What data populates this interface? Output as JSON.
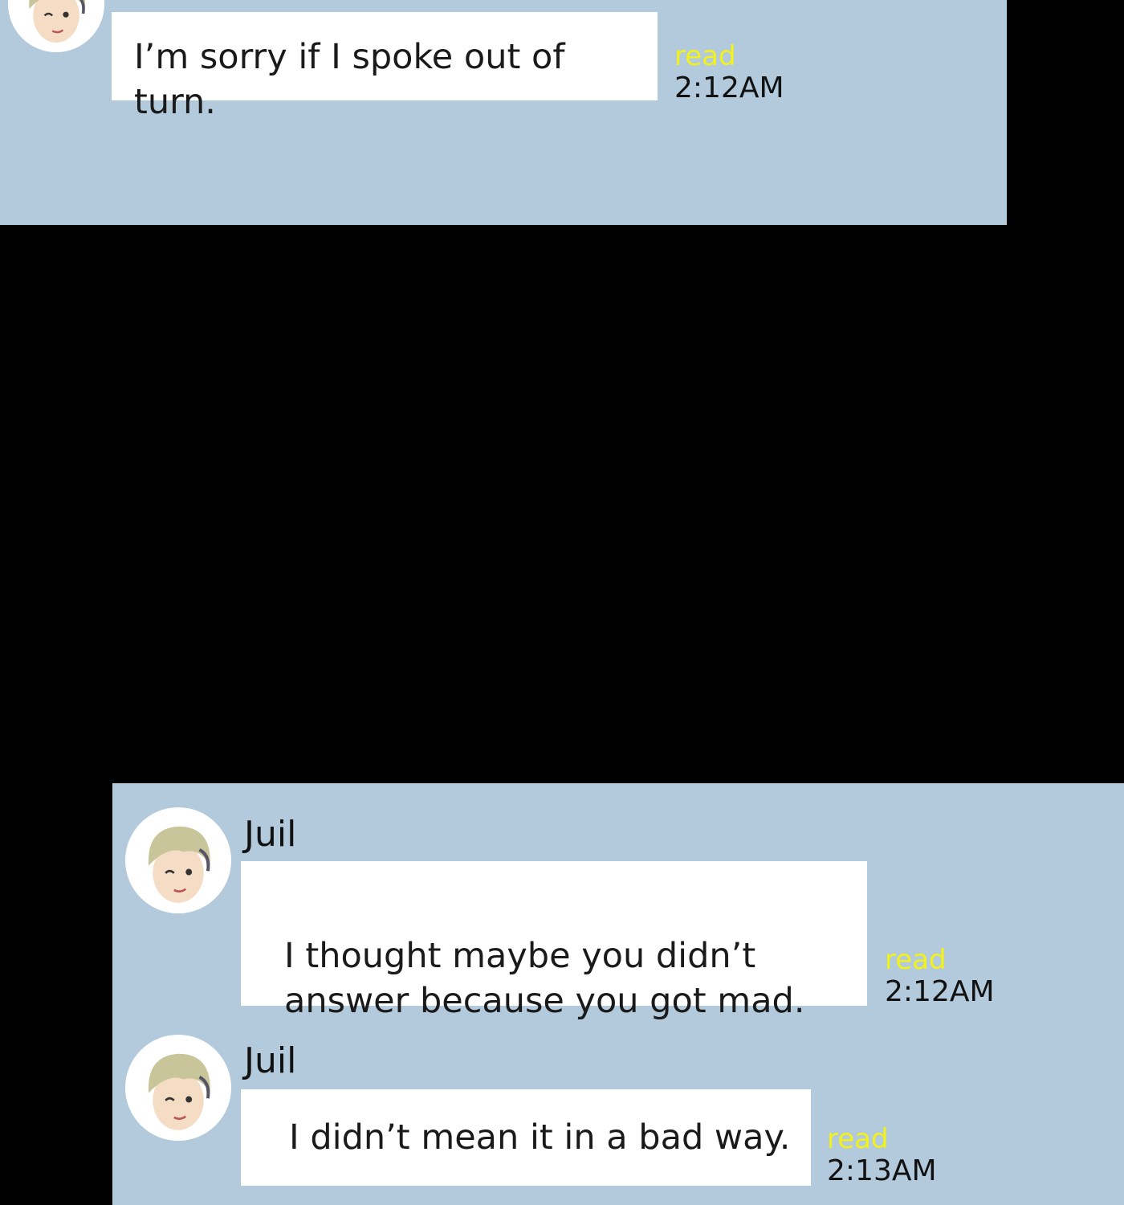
{
  "colors": {
    "background": "#000000",
    "chat_background": "#b2cadb",
    "bubble": "#ffffff",
    "read_indicator": "#f2f21a",
    "text": "#111111"
  },
  "messages": [
    {
      "sender": "",
      "text": "I’m sorry if I spoke out of turn.",
      "read_label": "read",
      "time": "2:12AM",
      "avatar_icon": "avatar-icon"
    },
    {
      "sender": "Juil",
      "text": "I thought maybe you didn’t\nanswer because you got mad.",
      "read_label": "read",
      "time": "2:12AM",
      "avatar_icon": "avatar-icon"
    },
    {
      "sender": "Juil",
      "text": "I didn’t mean it in a bad way.",
      "read_label": "read",
      "time": "2:13AM",
      "avatar_icon": "avatar-icon"
    }
  ]
}
